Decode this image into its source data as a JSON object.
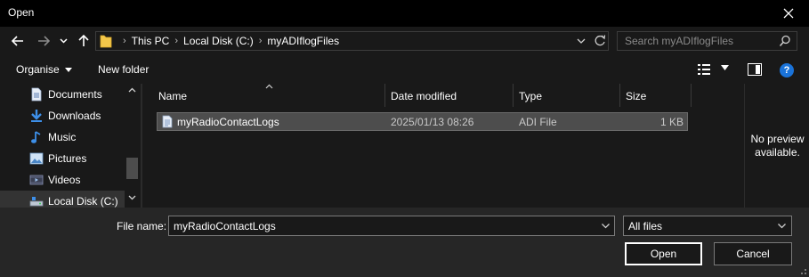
{
  "window": {
    "title": "Open"
  },
  "nav": {
    "breadcrumbs": [
      "This PC",
      "Local Disk (C:)",
      "myADIflogFiles"
    ],
    "search_placeholder": "Search myADIflogFiles"
  },
  "toolbar": {
    "organise_label": "Organise",
    "new_folder_label": "New folder",
    "help_label": "?"
  },
  "sidebar": {
    "items": [
      {
        "label": "Documents",
        "icon": "documents-icon"
      },
      {
        "label": "Downloads",
        "icon": "downloads-icon"
      },
      {
        "label": "Music",
        "icon": "music-icon"
      },
      {
        "label": "Pictures",
        "icon": "pictures-icon"
      },
      {
        "label": "Videos",
        "icon": "videos-icon"
      },
      {
        "label": "Local Disk (C:)",
        "icon": "drive-icon",
        "selected": true
      }
    ]
  },
  "filelist": {
    "columns": [
      "Name",
      "Date modified",
      "Type",
      "Size"
    ],
    "rows": [
      {
        "name": "myRadioContactLogs",
        "date": "2025/01/13 08:26",
        "type": "ADI File",
        "size": "1 KB",
        "selected": true
      }
    ]
  },
  "preview": {
    "line1": "No preview",
    "line2": "available."
  },
  "footer": {
    "filename_label": "File name:",
    "filename_value": "myRadioContactLogs",
    "filetype_value": "All files",
    "open_label": "Open",
    "cancel_label": "Cancel"
  },
  "colors": {
    "background": "#191919",
    "titlebar": "#000000",
    "selection": "#4d4d4d",
    "help_blue": "#1a73d9"
  }
}
